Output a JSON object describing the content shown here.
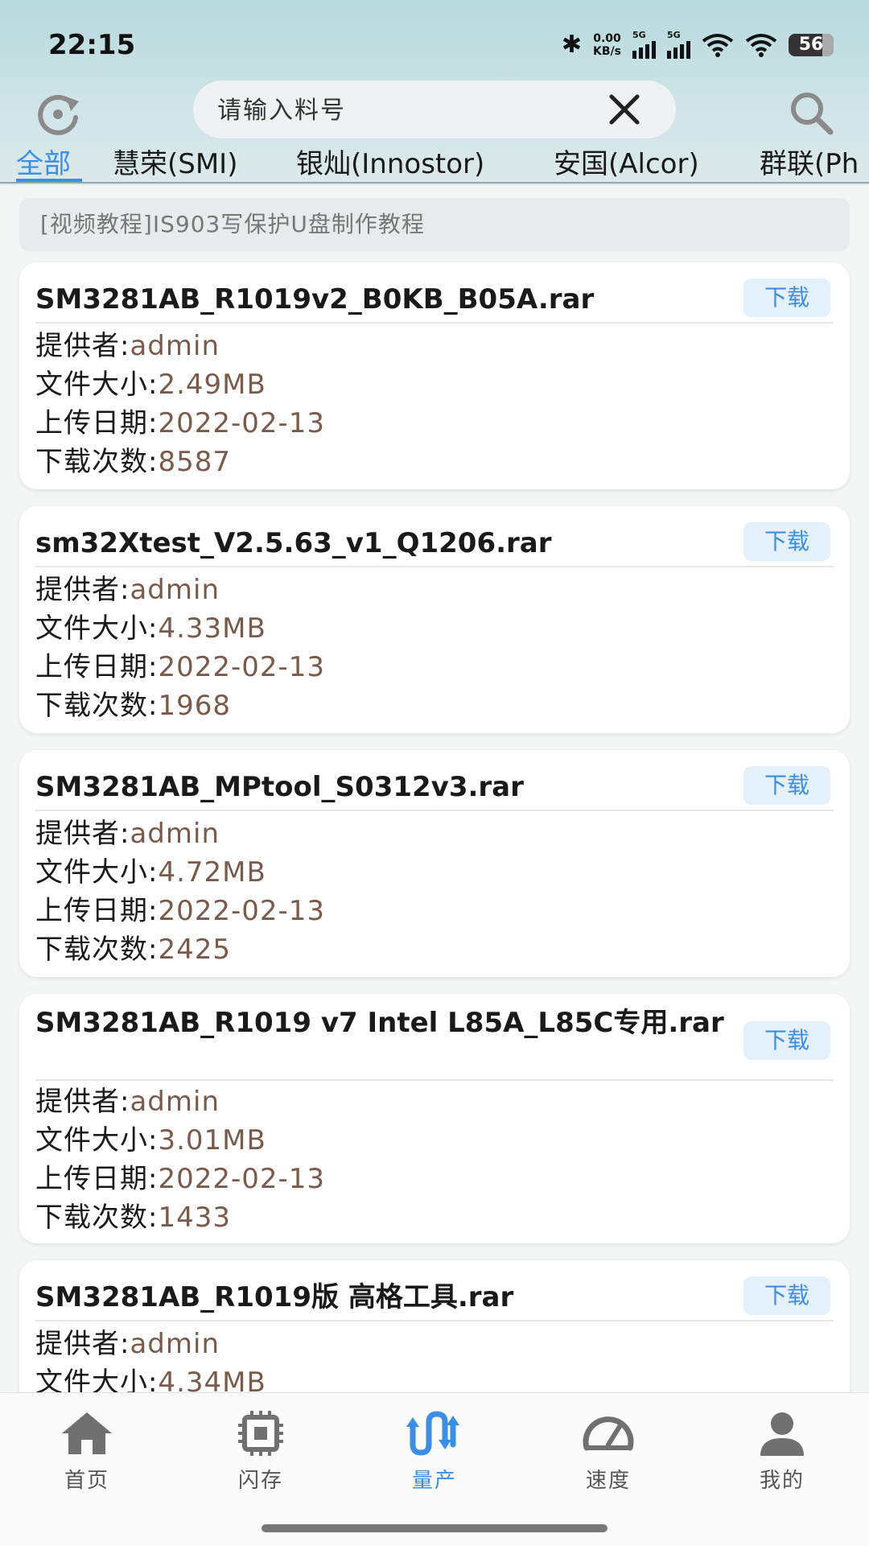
{
  "status_bar": {
    "time": "22:15",
    "speed_top": "0.00",
    "speed_unit": "KB/s",
    "sim1": "5G",
    "sim2": "5G",
    "battery": "56"
  },
  "search": {
    "placeholder": "请输入料号",
    "value": ""
  },
  "tabs": [
    {
      "label": "全部",
      "active": true
    },
    {
      "label": "慧荣(SMI)",
      "active": false
    },
    {
      "label": "银灿(Innostor)",
      "active": false
    },
    {
      "label": "安国(Alcor)",
      "active": false
    },
    {
      "label": "群联(Ph",
      "active": false
    }
  ],
  "notice": "[视频教程]IS903写保护U盘制作教程",
  "field_labels": {
    "provider": "提供者:",
    "size": "文件大小:",
    "date": "上传日期:",
    "downloads": "下载次数:"
  },
  "download_label": "下载",
  "files": [
    {
      "name": "SM3281AB_R1019v2_B0KB_B05A.rar",
      "provider": "admin",
      "size": "2.49MB",
      "date": "2022-02-13",
      "downloads": "8587"
    },
    {
      "name": "sm32Xtest_V2.5.63_v1_Q1206.rar",
      "provider": "admin",
      "size": "4.33MB",
      "date": "2022-02-13",
      "downloads": "1968"
    },
    {
      "name": "SM3281AB_MPtool_S0312v3.rar",
      "provider": "admin",
      "size": "4.72MB",
      "date": "2022-02-13",
      "downloads": "2425"
    },
    {
      "name": "SM3281AB_R1019 v7 Intel L85A_L85C专用.rar",
      "provider": "admin",
      "size": "3.01MB",
      "date": "2022-02-13",
      "downloads": "1433"
    },
    {
      "name": "SM3281AB_R1019版 高格工具.rar",
      "provider": "admin",
      "size": "4.34MB",
      "date": "",
      "downloads": ""
    }
  ],
  "bottom_nav": [
    {
      "label": "首页",
      "icon": "home-icon",
      "active": false
    },
    {
      "label": "闪存",
      "icon": "chip-icon",
      "active": false
    },
    {
      "label": "量产",
      "icon": "mass-production-icon",
      "active": true
    },
    {
      "label": "速度",
      "icon": "speedometer-icon",
      "active": false
    },
    {
      "label": "我的",
      "icon": "person-icon",
      "active": false
    }
  ],
  "colors": {
    "accent": "#3a8ee6",
    "value_text": "#7a5a4a",
    "header_top": "#b6d9dd"
  }
}
